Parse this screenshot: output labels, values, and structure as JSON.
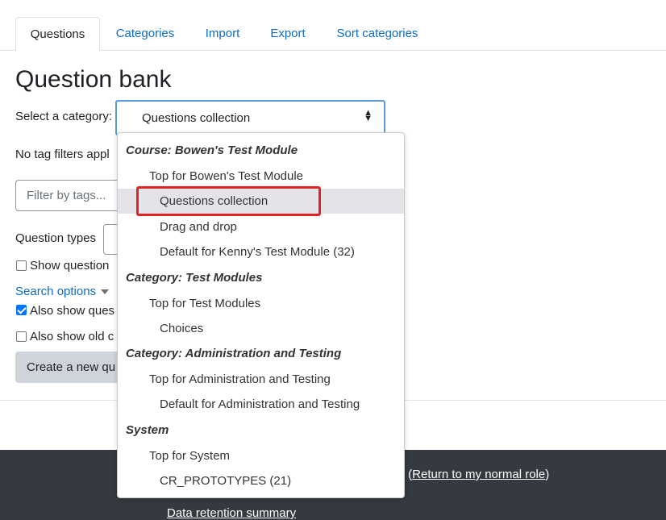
{
  "tabs": [
    {
      "label": "Questions",
      "active": true
    },
    {
      "label": "Categories"
    },
    {
      "label": "Import"
    },
    {
      "label": "Export"
    },
    {
      "label": "Sort categories"
    }
  ],
  "page_title": "Question bank",
  "category_select": {
    "label": "Select a category:",
    "selected_value": "Questions collection"
  },
  "tag_filter_text": "No tag filters appl",
  "filter_input": {
    "placeholder": "Filter by tags..."
  },
  "question_types_label": "Question types",
  "show_question_label": "Show question",
  "search_options_label": "Search options",
  "also_show_ques_label": "Also show ques",
  "also_show_old_label": "Also show old c",
  "create_button_label": "Create a new qu",
  "footer": {
    "role_text": "r (",
    "return_link": "Return to my normal role",
    "role_close": ")",
    "data_retention_link": "Data retention summary"
  },
  "dropdown": {
    "groups": [
      {
        "name": "Course: Bowen's Test Module",
        "options": [
          {
            "label": "Top for Bowen's Test Module",
            "indent": 1
          },
          {
            "label": "Questions collection",
            "indent": 2,
            "selected": true
          },
          {
            "label": "Drag and drop",
            "indent": 2
          },
          {
            "label": "Default for Kenny's Test Module (32)",
            "indent": 2
          }
        ]
      },
      {
        "name": "Category: Test Modules",
        "options": [
          {
            "label": "Top for Test Modules",
            "indent": 1
          },
          {
            "label": "Choices",
            "indent": 2
          }
        ]
      },
      {
        "name": "Category: Administration and Testing",
        "options": [
          {
            "label": "Top for Administration and Testing",
            "indent": 1
          },
          {
            "label": "Default for Administration and Testing",
            "indent": 2
          }
        ]
      },
      {
        "name": "System",
        "options": [
          {
            "label": "Top for System",
            "indent": 1
          },
          {
            "label": "CR_PROTOTYPES (21)",
            "indent": 2
          }
        ]
      }
    ]
  },
  "colors": {
    "link": "#0f6cbf",
    "footer_bg": "#343a40",
    "highlight": "#e02424",
    "selected_option_bg": "#e4e4e8"
  }
}
